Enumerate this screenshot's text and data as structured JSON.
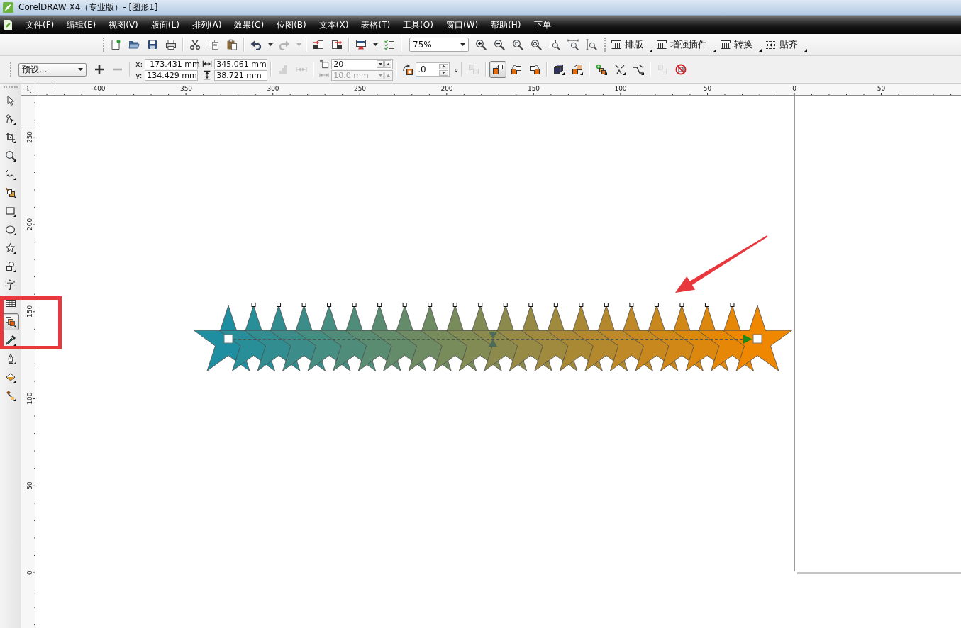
{
  "title_bar": {
    "title": "CorelDRAW X4（专业版）- [图形1]"
  },
  "menu_bar": {
    "items": [
      "文件(F)",
      "编辑(E)",
      "视图(V)",
      "版面(L)",
      "排列(A)",
      "效果(C)",
      "位图(B)",
      "文本(X)",
      "表格(T)",
      "工具(O)",
      "窗口(W)",
      "帮助(H)",
      "下单"
    ]
  },
  "standard_toolbar": {
    "groups": [
      [
        {
          "kind": "new",
          "disabled": false
        },
        {
          "kind": "open",
          "disabled": false
        },
        {
          "kind": "save",
          "disabled": false
        },
        {
          "kind": "print",
          "disabled": false
        }
      ],
      [
        {
          "kind": "cut",
          "disabled": false
        },
        {
          "kind": "copy",
          "disabled": false
        },
        {
          "kind": "paste",
          "disabled": false
        }
      ],
      [
        {
          "kind": "undo",
          "disabled": false
        },
        {
          "kind": "dropdown",
          "disabled": false
        },
        {
          "kind": "redo",
          "disabled": true
        },
        {
          "kind": "dropdown",
          "disabled": true
        }
      ],
      [
        {
          "kind": "import",
          "disabled": false
        },
        {
          "kind": "export",
          "disabled": false
        }
      ],
      [
        {
          "kind": "launcher",
          "disabled": false
        },
        {
          "kind": "dropdown",
          "disabled": false
        },
        {
          "kind": "options",
          "disabled": false
        }
      ]
    ],
    "zoom_level": "75%",
    "zoom_tools": [
      {
        "kind": "zoom_in"
      },
      {
        "kind": "zoom_out"
      },
      {
        "kind": "zoom_selected"
      },
      {
        "kind": "zoom_all"
      },
      {
        "kind": "zoom_page"
      },
      {
        "kind": "zoom_width"
      },
      {
        "kind": "zoom_height"
      }
    ],
    "buttons": [
      {
        "kind": "layout",
        "label": "排版"
      },
      {
        "kind": "layout",
        "label": "增强插件"
      },
      {
        "kind": "layout",
        "label": "转换"
      },
      {
        "kind": "snap",
        "label": "贴齐"
      }
    ]
  },
  "property_bar": {
    "preset": "预设...",
    "preset_actions": [
      {
        "kind": "add",
        "disabled": false
      },
      {
        "kind": "remove",
        "disabled": true
      }
    ],
    "position": [
      {
        "label": "x:",
        "value": "-173.431 mm"
      },
      {
        "label": "y:",
        "value": "134.429 mm"
      }
    ],
    "size": [
      {
        "kind": "width",
        "value": "345.061 mm"
      },
      {
        "kind": "height",
        "value": "38.721 mm"
      }
    ],
    "path_tools": [
      {
        "kind": "stairs",
        "disabled": true
      },
      {
        "kind": "ruler_arrow",
        "disabled": true
      }
    ],
    "blend_fields": [
      {
        "kind": "steps",
        "value": "20",
        "disabled": false
      },
      {
        "kind": "spacing",
        "value": "10.0 mm",
        "disabled": true
      }
    ],
    "rotation": {
      "value": ".0",
      "unit": "°"
    },
    "loop": {
      "disabled": true
    },
    "blend_direction": [
      {
        "kind": "direct",
        "selected": true
      },
      {
        "kind": "clockwise",
        "selected": false
      },
      {
        "kind": "counterclockwise",
        "selected": false
      }
    ],
    "acceleration": [
      {
        "kind": "stack"
      },
      {
        "kind": "accelerate"
      }
    ],
    "more_tools": [
      {
        "kind": "start_end"
      },
      {
        "kind": "path"
      },
      {
        "kind": "more"
      }
    ],
    "end_tools": [
      {
        "kind": "copy_props",
        "disabled": true
      },
      {
        "kind": "clear",
        "disabled": false
      }
    ]
  },
  "toolbox": [
    {
      "kind": "pick",
      "selected": false
    },
    {
      "kind": "shape",
      "selected": false
    },
    {
      "kind": "crop",
      "selected": false
    },
    {
      "kind": "zoom",
      "selected": false
    },
    {
      "kind": "freehand",
      "selected": false
    },
    {
      "kind": "smart_fill",
      "selected": false
    },
    {
      "kind": "rectangle",
      "selected": false
    },
    {
      "kind": "ellipse",
      "selected": false
    },
    {
      "kind": "polygon",
      "selected": false
    },
    {
      "kind": "basic_shapes",
      "selected": false
    },
    {
      "kind": "text",
      "label": "字",
      "selected": false
    },
    {
      "kind": "table",
      "selected": false
    },
    {
      "kind": "blend",
      "selected": true
    },
    {
      "kind": "eyedropper",
      "selected": false
    },
    {
      "kind": "outline",
      "selected": false
    },
    {
      "kind": "fill",
      "selected": false
    },
    {
      "kind": "interactive_fill",
      "selected": false
    }
  ],
  "rulers": {
    "horizontal": [
      "400",
      "350",
      "300",
      "250",
      "200",
      "150",
      "100",
      "50",
      "0",
      "50"
    ],
    "vertical": [
      "250",
      "200",
      "150",
      "100",
      "50",
      "0"
    ]
  },
  "canvas": {
    "blend": {
      "stars": [
        {
          "kind": "control",
          "color": "#1e8ea0"
        },
        {
          "kind": "step",
          "color": "#288e98"
        },
        {
          "kind": "step",
          "color": "#328d91"
        },
        {
          "kind": "step",
          "color": "#3c8d89"
        },
        {
          "kind": "step",
          "color": "#468d82"
        },
        {
          "kind": "step",
          "color": "#508c7a"
        },
        {
          "kind": "step",
          "color": "#5a8c72"
        },
        {
          "kind": "step",
          "color": "#648c6b"
        },
        {
          "kind": "step",
          "color": "#6e8b63"
        },
        {
          "kind": "step",
          "color": "#788b5b"
        },
        {
          "kind": "step",
          "color": "#828b54"
        },
        {
          "kind": "step",
          "color": "#8c8a4c"
        },
        {
          "kind": "step",
          "color": "#968a45"
        },
        {
          "kind": "step",
          "color": "#a08a3d"
        },
        {
          "kind": "step",
          "color": "#aa8935"
        },
        {
          "kind": "step",
          "color": "#b4892e"
        },
        {
          "kind": "step",
          "color": "#be8926"
        },
        {
          "kind": "step",
          "color": "#c8881e"
        },
        {
          "kind": "step",
          "color": "#d28817"
        },
        {
          "kind": "step",
          "color": "#dc880f"
        },
        {
          "kind": "step",
          "color": "#e68708"
        },
        {
          "kind": "control",
          "color": "#f08700"
        }
      ]
    }
  }
}
